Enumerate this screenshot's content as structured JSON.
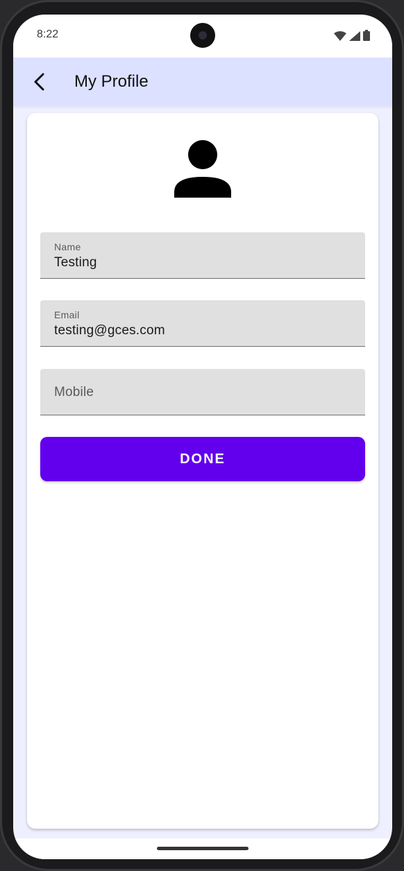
{
  "status_bar": {
    "time": "8:22",
    "icons": [
      "wifi-icon",
      "cellular-signal-icon",
      "battery-icon"
    ]
  },
  "app_bar": {
    "back_icon": "arrow-back-icon",
    "title": "My Profile"
  },
  "profile": {
    "avatar_icon": "person-icon",
    "fields": [
      {
        "label": "Name",
        "value": "Testing"
      },
      {
        "label": "Email",
        "value": "testing@gces.com"
      },
      {
        "label": "Mobile",
        "value": ""
      }
    ],
    "done_label": "DONE"
  },
  "colors": {
    "app_bar_bg": "#dbe1ff",
    "screen_bg": "#eef0ff",
    "field_bg": "#e0e0e0",
    "button_bg": "#6200ee",
    "button_text": "#ffffff"
  }
}
